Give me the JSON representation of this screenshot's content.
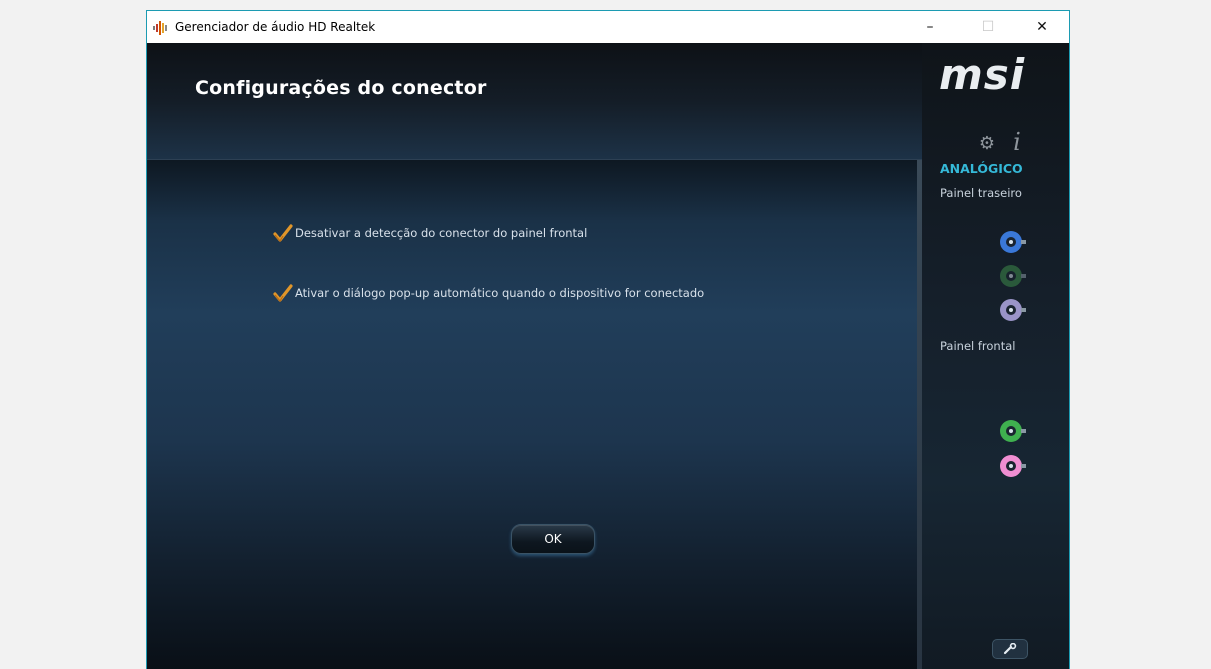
{
  "window": {
    "title": "Gerenciador de áudio HD Realtek",
    "controls": {
      "minimize": "–",
      "maximize": "☐",
      "close": "✕"
    }
  },
  "header": {
    "heading": "Configurações do conector"
  },
  "options": [
    {
      "label": "Desativar a detecção do conector do painel frontal",
      "checked": true
    },
    {
      "label": "Ativar o diálogo pop-up automático quando o dispositivo for conectado",
      "checked": true
    }
  ],
  "ok_button": {
    "label": "OK"
  },
  "sidebar": {
    "brand": "msi",
    "section": "ANALÓGICO",
    "back_panel_label": "Painel traseiro",
    "front_panel_label": "Painel frontal",
    "back_jacks": [
      {
        "color": "#3a78d8",
        "active": true
      },
      {
        "color": "#3c8a4a",
        "active": false
      },
      {
        "color": "#9a94c8",
        "active": true
      }
    ],
    "front_jacks": [
      {
        "color": "#3fb04f",
        "active": true
      },
      {
        "color": "#f08ed2",
        "active": true
      }
    ],
    "tool_icon": "wrench-icon"
  },
  "colors": {
    "accent": "#35b9d8",
    "checkmark": "#e0962a"
  }
}
